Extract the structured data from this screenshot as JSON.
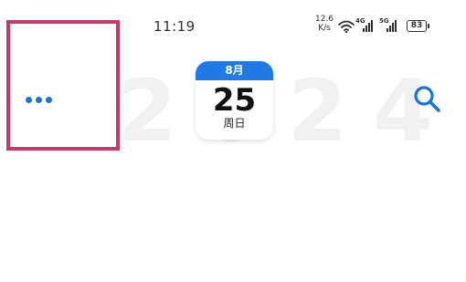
{
  "status_bar": {
    "time": "11:19",
    "net_speed_value": "12.6",
    "net_speed_unit": "K/s",
    "signal_1_tag": "4G",
    "signal_2_tag": "5G",
    "battery_level": "83"
  },
  "header": {
    "year_watermark": "2024",
    "calendar": {
      "month": "8月",
      "day": "25",
      "weekday": "周日"
    }
  },
  "colors": {
    "accent": "#1f7ae8",
    "highlight": "#c8366b",
    "icon_blue": "#1a73d9"
  },
  "icons": {
    "more": "more-dots-icon",
    "search": "search-icon",
    "wifi": "wifi-icon",
    "signal": "signal-icon",
    "battery": "battery-icon"
  }
}
